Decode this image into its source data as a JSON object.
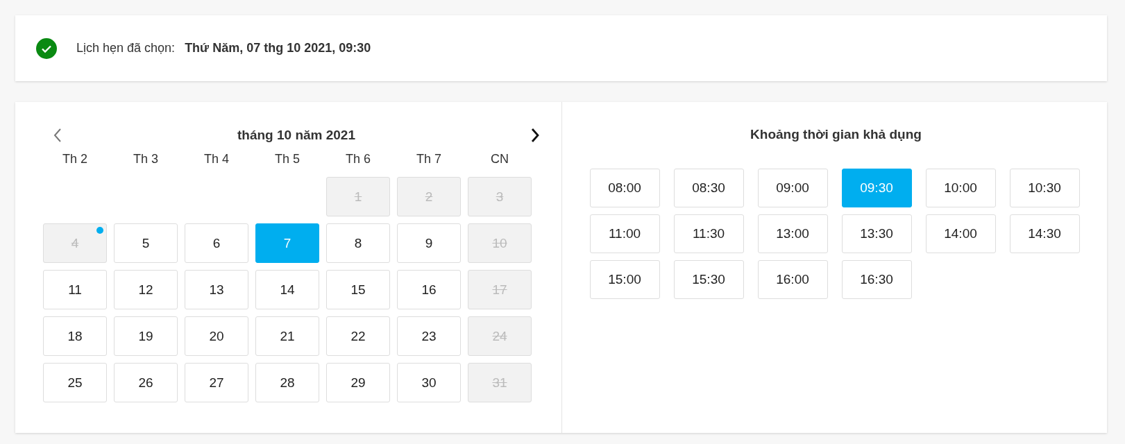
{
  "summary": {
    "confirmed": true,
    "label": "Lịch hẹn đã chọn:",
    "value": "Thứ Năm, 07 thg 10 2021, 09:30"
  },
  "calendar": {
    "title": "tháng 10 năm 2021",
    "prev_disabled": true,
    "next_disabled": false,
    "weekdays": [
      "Th 2",
      "Th 3",
      "Th 4",
      "Th 5",
      "Th 6",
      "Th 7",
      "CN"
    ],
    "days": [
      {
        "kind": "empty"
      },
      {
        "kind": "empty"
      },
      {
        "kind": "empty"
      },
      {
        "kind": "empty"
      },
      {
        "kind": "day",
        "label": "1",
        "disabled": true,
        "selected": false,
        "today": false
      },
      {
        "kind": "day",
        "label": "2",
        "disabled": true,
        "selected": false,
        "today": false
      },
      {
        "kind": "day",
        "label": "3",
        "disabled": true,
        "selected": false,
        "today": false
      },
      {
        "kind": "day",
        "label": "4",
        "disabled": true,
        "selected": false,
        "today": true
      },
      {
        "kind": "day",
        "label": "5",
        "disabled": false,
        "selected": false,
        "today": false
      },
      {
        "kind": "day",
        "label": "6",
        "disabled": false,
        "selected": false,
        "today": false
      },
      {
        "kind": "day",
        "label": "7",
        "disabled": false,
        "selected": true,
        "today": false
      },
      {
        "kind": "day",
        "label": "8",
        "disabled": false,
        "selected": false,
        "today": false
      },
      {
        "kind": "day",
        "label": "9",
        "disabled": false,
        "selected": false,
        "today": false
      },
      {
        "kind": "day",
        "label": "10",
        "disabled": true,
        "selected": false,
        "today": false
      },
      {
        "kind": "day",
        "label": "11",
        "disabled": false,
        "selected": false,
        "today": false
      },
      {
        "kind": "day",
        "label": "12",
        "disabled": false,
        "selected": false,
        "today": false
      },
      {
        "kind": "day",
        "label": "13",
        "disabled": false,
        "selected": false,
        "today": false
      },
      {
        "kind": "day",
        "label": "14",
        "disabled": false,
        "selected": false,
        "today": false
      },
      {
        "kind": "day",
        "label": "15",
        "disabled": false,
        "selected": false,
        "today": false
      },
      {
        "kind": "day",
        "label": "16",
        "disabled": false,
        "selected": false,
        "today": false
      },
      {
        "kind": "day",
        "label": "17",
        "disabled": true,
        "selected": false,
        "today": false
      },
      {
        "kind": "day",
        "label": "18",
        "disabled": false,
        "selected": false,
        "today": false
      },
      {
        "kind": "day",
        "label": "19",
        "disabled": false,
        "selected": false,
        "today": false
      },
      {
        "kind": "day",
        "label": "20",
        "disabled": false,
        "selected": false,
        "today": false
      },
      {
        "kind": "day",
        "label": "21",
        "disabled": false,
        "selected": false,
        "today": false
      },
      {
        "kind": "day",
        "label": "22",
        "disabled": false,
        "selected": false,
        "today": false
      },
      {
        "kind": "day",
        "label": "23",
        "disabled": false,
        "selected": false,
        "today": false
      },
      {
        "kind": "day",
        "label": "24",
        "disabled": true,
        "selected": false,
        "today": false
      },
      {
        "kind": "day",
        "label": "25",
        "disabled": false,
        "selected": false,
        "today": false
      },
      {
        "kind": "day",
        "label": "26",
        "disabled": false,
        "selected": false,
        "today": false
      },
      {
        "kind": "day",
        "label": "27",
        "disabled": false,
        "selected": false,
        "today": false
      },
      {
        "kind": "day",
        "label": "28",
        "disabled": false,
        "selected": false,
        "today": false
      },
      {
        "kind": "day",
        "label": "29",
        "disabled": false,
        "selected": false,
        "today": false
      },
      {
        "kind": "day",
        "label": "30",
        "disabled": false,
        "selected": false,
        "today": false
      },
      {
        "kind": "day",
        "label": "31",
        "disabled": true,
        "selected": false,
        "today": false
      }
    ]
  },
  "time_slots": {
    "title": "Khoảng thời gian khả dụng",
    "slots": [
      {
        "label": "08:00",
        "selected": false
      },
      {
        "label": "08:30",
        "selected": false
      },
      {
        "label": "09:00",
        "selected": false
      },
      {
        "label": "09:30",
        "selected": true
      },
      {
        "label": "10:00",
        "selected": false
      },
      {
        "label": "10:30",
        "selected": false
      },
      {
        "label": "11:00",
        "selected": false
      },
      {
        "label": "11:30",
        "selected": false
      },
      {
        "label": "13:00",
        "selected": false
      },
      {
        "label": "13:30",
        "selected": false
      },
      {
        "label": "14:00",
        "selected": false
      },
      {
        "label": "14:30",
        "selected": false
      },
      {
        "label": "15:00",
        "selected": false
      },
      {
        "label": "15:30",
        "selected": false
      },
      {
        "label": "16:00",
        "selected": false
      },
      {
        "label": "16:30",
        "selected": false
      }
    ]
  }
}
